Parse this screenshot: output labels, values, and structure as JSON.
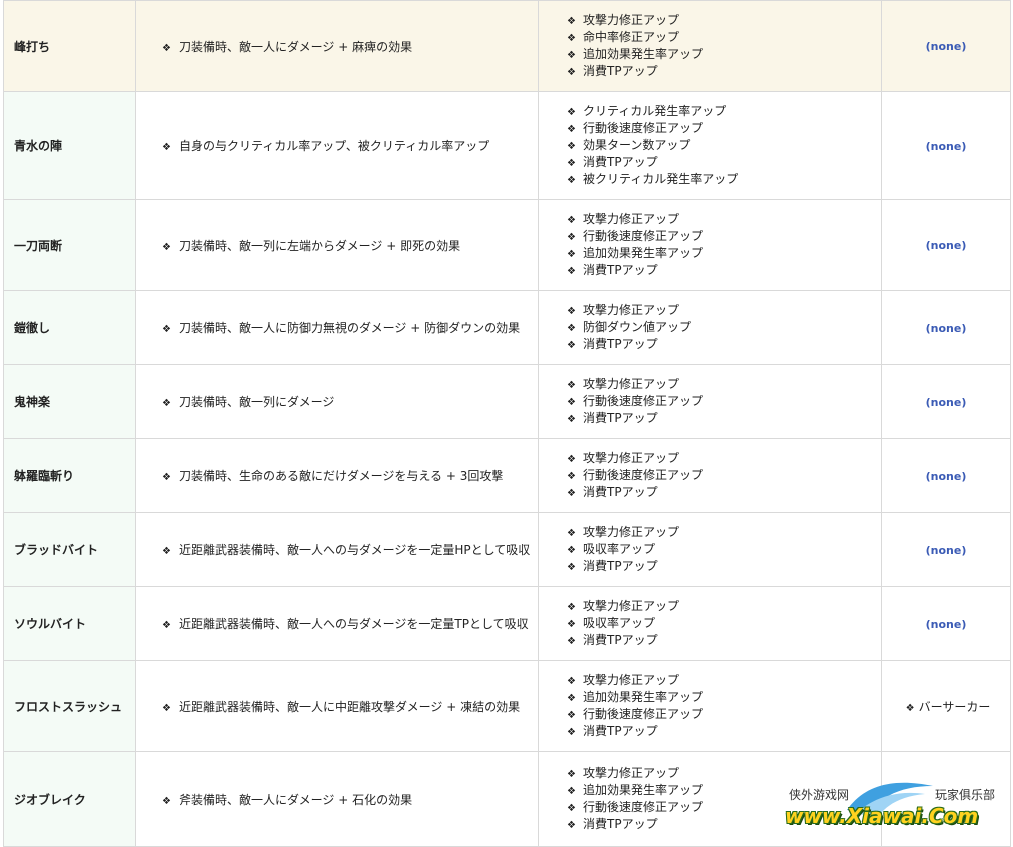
{
  "bullet": "❖",
  "rows": [
    {
      "name": "峰打ち",
      "description": "刀装備時、敵一人にダメージ + 麻痺の効果",
      "modifiers": [
        "攻撃力修正アップ",
        "命中率修正アップ",
        "追加効果発生率アップ",
        "消費TPアップ"
      ],
      "class": "(none)",
      "highlighted": true
    },
    {
      "name": "青水の陣",
      "description": "自身の与クリティカル率アップ、被クリティカル率アップ",
      "modifiers": [
        "クリティカル発生率アップ",
        "行動後速度修正アップ",
        "効果ターン数アップ",
        "消費TPアップ",
        "被クリティカル発生率アップ"
      ],
      "class": "(none)"
    },
    {
      "name": "一刀両断",
      "description": "刀装備時、敵一列に左端からダメージ + 即死の効果",
      "modifiers": [
        "攻撃力修正アップ",
        "行動後速度修正アップ",
        "追加効果発生率アップ",
        "消費TPアップ"
      ],
      "class": "(none)"
    },
    {
      "name": "鎧徹し",
      "description": "刀装備時、敵一人に防御力無視のダメージ + 防御ダウンの効果",
      "modifiers": [
        "攻撃力修正アップ",
        "防御ダウン値アップ",
        "消費TPアップ"
      ],
      "class": "(none)"
    },
    {
      "name": "鬼神楽",
      "description": "刀装備時、敵一列にダメージ",
      "modifiers": [
        "攻撃力修正アップ",
        "行動後速度修正アップ",
        "消費TPアップ"
      ],
      "class": "(none)"
    },
    {
      "name": "躰羅臨斬り",
      "description": "刀装備時、生命のある敵にだけダメージを与える + 3回攻撃",
      "modifiers": [
        "攻撃力修正アップ",
        "行動後速度修正アップ",
        "消費TPアップ"
      ],
      "class": "(none)"
    },
    {
      "name": "ブラッドバイト",
      "description": "近距離武器装備時、敵一人への与ダメージを一定量HPとして吸収",
      "modifiers": [
        "攻撃力修正アップ",
        "吸収率アップ",
        "消費TPアップ"
      ],
      "class": "(none)"
    },
    {
      "name": "ソウルバイト",
      "description": "近距離武器装備時、敵一人への与ダメージを一定量TPとして吸収",
      "modifiers": [
        "攻撃力修正アップ",
        "吸収率アップ",
        "消費TPアップ"
      ],
      "class": "(none)"
    },
    {
      "name": "フロストスラッシュ",
      "description": "近距離武器装備時、敵一人に中距離攻撃ダメージ + 凍結の効果",
      "modifiers": [
        "攻撃力修正アップ",
        "追加効果発生率アップ",
        "行動後速度修正アップ",
        "消費TPアップ"
      ],
      "class": "バーサーカー",
      "class_bulleted": true
    },
    {
      "name": "ジオブレイク",
      "description": "斧装備時、敵一人にダメージ + 石化の効果",
      "modifiers": [
        "攻撃力修正アップ",
        "追加効果発生率アップ",
        "行動後速度修正アップ",
        "消費TPアップ"
      ],
      "class": ""
    }
  ],
  "watermark": {
    "site_cn": "侠外游戏网",
    "club_cn": "玩家俱乐部",
    "logo": "www.Xiawai.Com"
  },
  "colors": {
    "name_bg": "#f4fbf6",
    "highlight_bg": "#faf6e8",
    "none_text": "#3b5bb5",
    "border": "#d9d9d9"
  }
}
